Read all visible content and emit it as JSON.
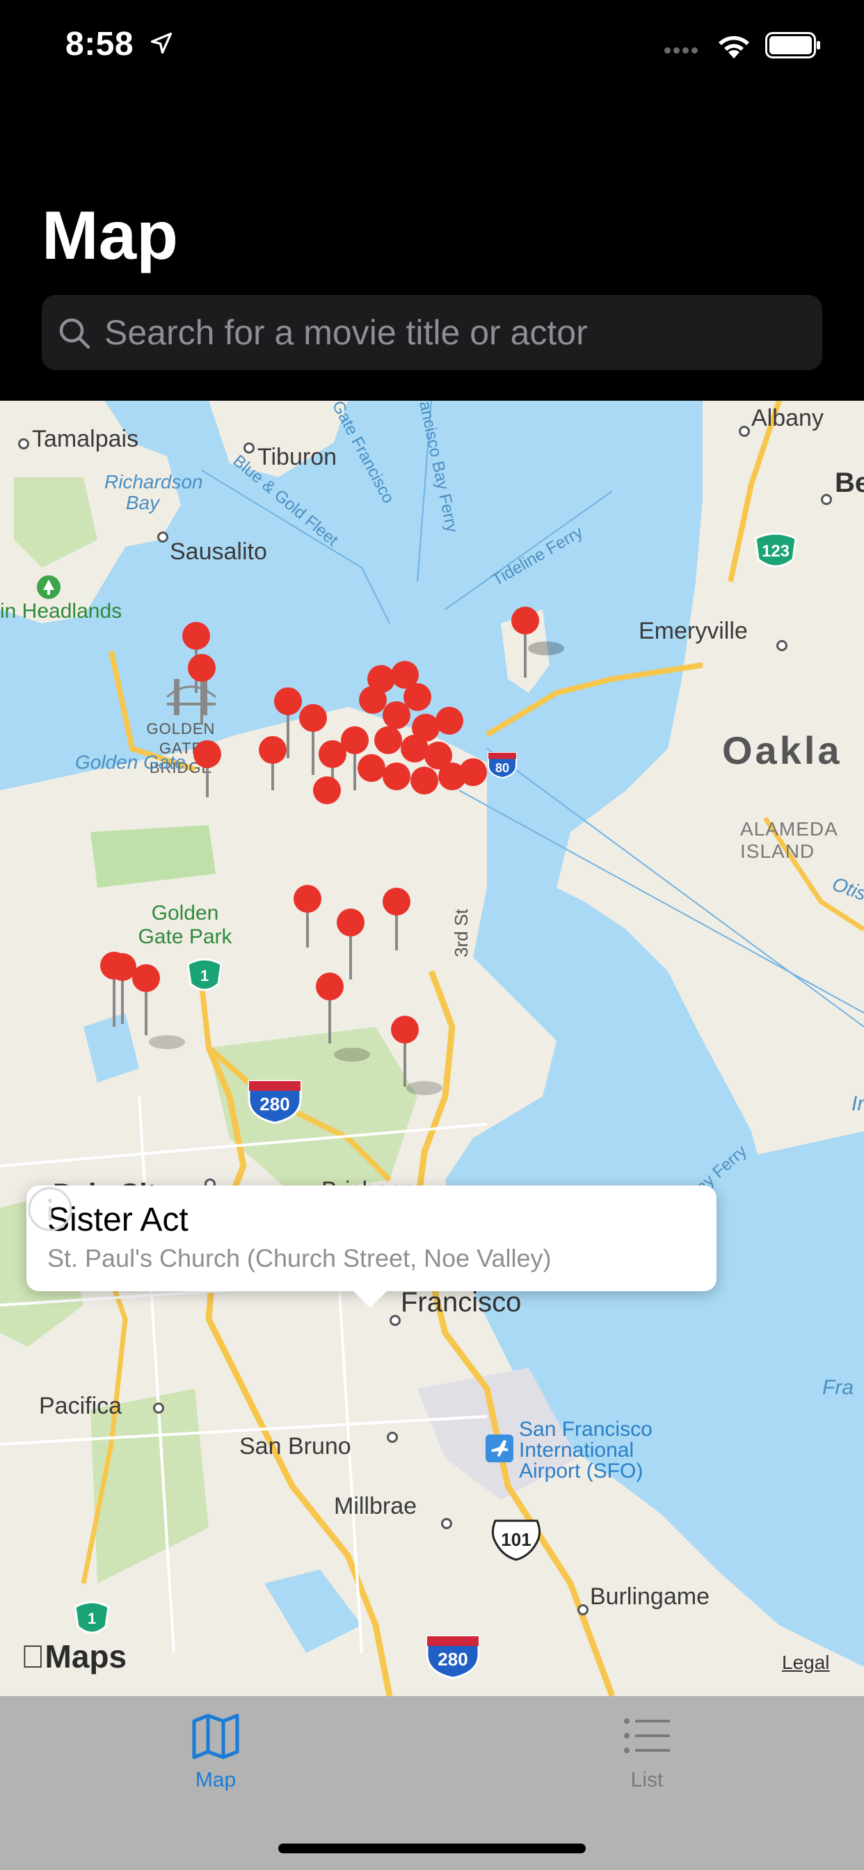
{
  "status_bar": {
    "time": "8:58",
    "icons": [
      "location-arrow-icon",
      "cellular-dots-icon",
      "wifi-icon",
      "battery-icon"
    ]
  },
  "header": {
    "title": "Map",
    "search_placeholder": "Search for a movie title or actor"
  },
  "map": {
    "labels": {
      "tamalpais": "Tamalpais",
      "richardson_bay": "Richardson Bay",
      "tiburon": "Tiburon",
      "sausalito": "Sausalito",
      "marin_headlands": "in Headlands",
      "golden_gate_bridge": "GOLDEN GATE BRIDGE",
      "golden_gate": "Golden Gate",
      "golden_gate_park": "Golden Gate Park",
      "albany": "Albany",
      "berkeley": "Be",
      "emeryville": "Emeryville",
      "oakland": "Oakla",
      "alameda": "ALAMEDA ISLAND",
      "otis": "Otis",
      "daly_city": "Daly City",
      "brisbane": "Brisbane",
      "south_san_francisco": "South San Francisco",
      "pacifica": "Pacifica",
      "san_bruno": "San Bruno",
      "millbrae": "Millbrae",
      "burlingame": "Burlingame",
      "sfo": "San Francisco International Airport (SFO)",
      "third_st": "3rd St",
      "gate_francisco": "Gate Francisco",
      "sf_bay_ferry": "Francisco Bay Ferry",
      "tideline_ferry": "Tideline Ferry",
      "blue_gold_fleet": "Blue & Gold Fleet",
      "sf_bay_ferry_south": "San Francisco Bay Ferry",
      "fra": "Fra",
      "in_label": "In"
    },
    "shields": {
      "ca1_north": "1",
      "ca1_south": "1",
      "i280_north": "280",
      "i280_south": "280",
      "us101": "101",
      "ca123": "123",
      "i80": "80"
    },
    "callout": {
      "title": "Sister Act",
      "subtitle": "St. Paul's Church (Church Street, Noe Valley)"
    },
    "attribution": "Maps",
    "legal": "Legal",
    "pin_color": "#e8332b"
  },
  "tab_bar": {
    "tabs": [
      {
        "label": "Map",
        "selected": true,
        "icon": "map-icon"
      },
      {
        "label": "List",
        "selected": false,
        "icon": "list-icon"
      }
    ],
    "accent": "#1a7bd8"
  }
}
